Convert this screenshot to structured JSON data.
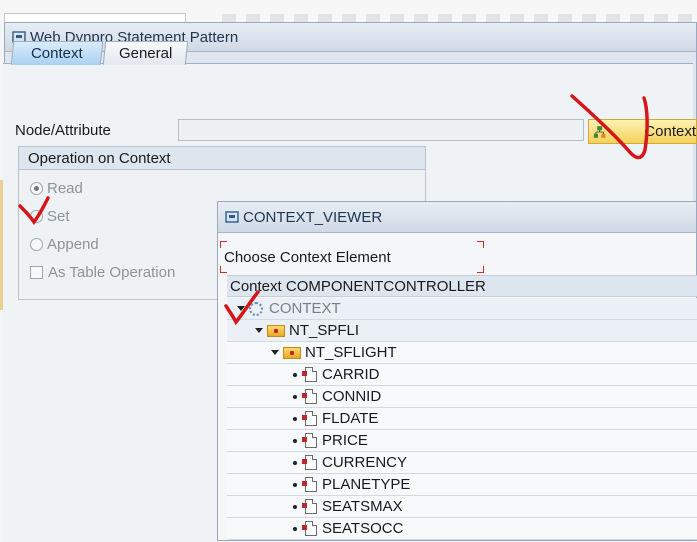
{
  "dialog": {
    "title": "Web Dynpro Statement Pattern",
    "tabs": [
      {
        "label": "Context",
        "active": true
      },
      {
        "label": "General",
        "active": false
      }
    ],
    "node_attribute_label": "Node/Attribute",
    "node_attribute_value": "",
    "context_button_label": "Context",
    "operation_group": {
      "title": "Operation on Context",
      "options": [
        {
          "label": "Read",
          "type": "radio",
          "selected": true
        },
        {
          "label": "Set",
          "type": "radio",
          "selected": false
        },
        {
          "label": "Append",
          "type": "radio",
          "selected": false
        },
        {
          "label": "As Table Operation",
          "type": "checkbox",
          "checked": false
        }
      ]
    }
  },
  "viewer": {
    "title": "CONTEXT_VIEWER",
    "prompt": "Choose Context Element",
    "tree_header": "Context COMPONENTCONTROLLER",
    "tree": [
      {
        "label": "CONTEXT",
        "kind": "root"
      },
      {
        "label": "NT_SPFLI",
        "kind": "node"
      },
      {
        "label": "NT_SFLIGHT",
        "kind": "node"
      },
      {
        "label": "CARRID",
        "kind": "attribute"
      },
      {
        "label": "CONNID",
        "kind": "attribute"
      },
      {
        "label": "FLDATE",
        "kind": "attribute"
      },
      {
        "label": "PRICE",
        "kind": "attribute"
      },
      {
        "label": "CURRENCY",
        "kind": "attribute"
      },
      {
        "label": "PLANETYPE",
        "kind": "attribute"
      },
      {
        "label": "SEATSMAX",
        "kind": "attribute"
      },
      {
        "label": "SEATSOCC",
        "kind": "attribute"
      }
    ]
  },
  "colors": {
    "annotation_red": "#d4161b",
    "active_tab": "#a9d2f1",
    "context_button": "#f4d15a"
  }
}
